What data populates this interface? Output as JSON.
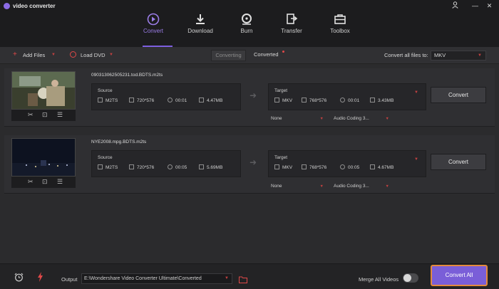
{
  "app": {
    "title": "video converter"
  },
  "window_controls": [
    "person-icon",
    "minimize-icon",
    "close-icon"
  ],
  "nav": {
    "tabs": [
      {
        "label": "Convert",
        "icon": "convert-icon",
        "active": true
      },
      {
        "label": "Download",
        "icon": "download-icon",
        "active": false
      },
      {
        "label": "Burn",
        "icon": "burn-disc-icon",
        "active": false
      },
      {
        "label": "Transfer",
        "icon": "transfer-icon",
        "active": false
      },
      {
        "label": "Toolbox",
        "icon": "toolbox-icon",
        "active": false
      }
    ],
    "accent": "#8b6be6"
  },
  "toolbar": {
    "add_files": "Add Files",
    "load_dvd": "Load DVD",
    "segment_converting": "Converting",
    "segment_converted": "Converted",
    "convert_all_to_label": "Convert all files to:",
    "format_value": "MKV"
  },
  "files": [
    {
      "name": "090313062505231.tod.BDTS.m2ts",
      "source_label": "Source",
      "source": {
        "format": "M2TS",
        "resolution": "720*576",
        "duration": "00:01",
        "size": "4.47MB"
      },
      "target_label": "Target",
      "target": {
        "format": "MKV",
        "resolution": "768*576",
        "duration": "00:01",
        "size": "3.43MB"
      },
      "subtitle": "None",
      "audio": "Audio Coding 3...",
      "convert_label": "Convert"
    },
    {
      "name": "NYE2008.mpg.BDTS.m2ts",
      "source_label": "Source",
      "source": {
        "format": "M2TS",
        "resolution": "720*576",
        "duration": "00:05",
        "size": "5.69MB"
      },
      "target_label": "Target",
      "target": {
        "format": "MKV",
        "resolution": "768*576",
        "duration": "00:05",
        "size": "4.67MB"
      },
      "subtitle": "None",
      "audio": "Audio Coding 3...",
      "convert_label": "Convert"
    }
  ],
  "bottom": {
    "output_label": "Output",
    "output_path": "E:\\Wondershare Video Converter Ultimate\\Converted",
    "merge_label": "Merge All Videos",
    "convert_all_label": "Convert All"
  },
  "colors": {
    "convert_all_bg": "#7a5ed8",
    "convert_all_border": "#e48a3e",
    "status_red": "#c04040"
  }
}
